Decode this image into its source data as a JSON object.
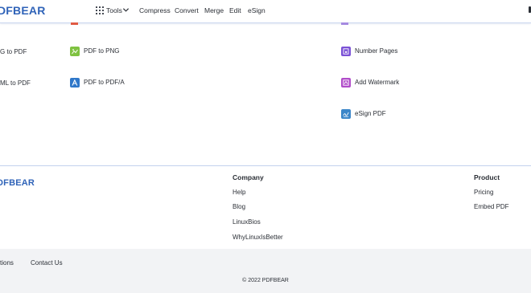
{
  "brand": {
    "logo_text": "DFBEAR",
    "colors": {
      "brand_blue": "#2f63b8"
    }
  },
  "nav": {
    "items": [
      {
        "label": "Tools",
        "icon": "grid-icon",
        "has_dropdown": true
      },
      {
        "label": "Compress"
      },
      {
        "label": "Convert"
      },
      {
        "label": "Merge"
      },
      {
        "label": "Edit"
      },
      {
        "label": "eSign"
      }
    ]
  },
  "tools": {
    "col1": [
      {
        "label": "G to PDF"
      },
      {
        "label": "ML to PDF"
      }
    ],
    "col2": [
      {
        "label": "PDF to PNG",
        "icon": "image-icon",
        "color": "#7fc241"
      },
      {
        "label": "PDF to PDF/A",
        "icon": "pdfa-icon",
        "color": "#2f77c9"
      }
    ],
    "col3": [
      {
        "label": "Number Pages",
        "icon": "number-pages-icon",
        "color": "#7b52d6"
      },
      {
        "label": "Add Watermark",
        "icon": "watermark-icon",
        "color": "#b04cc9"
      },
      {
        "label": "eSign PDF",
        "icon": "esign-icon",
        "color": "#3b86c9"
      }
    ]
  },
  "footer": {
    "logo_text": "DFBEAR",
    "company": {
      "heading": "Company",
      "links": [
        "Help",
        "Blog",
        "LinuxBios",
        "WhyLinuxIsBetter"
      ]
    },
    "product": {
      "heading": "Product",
      "links": [
        "Pricing",
        "Embed PDF"
      ]
    },
    "bottom_links": [
      "tions",
      "Contact Us"
    ],
    "copyright": "© 2022 PDFBEAR"
  }
}
